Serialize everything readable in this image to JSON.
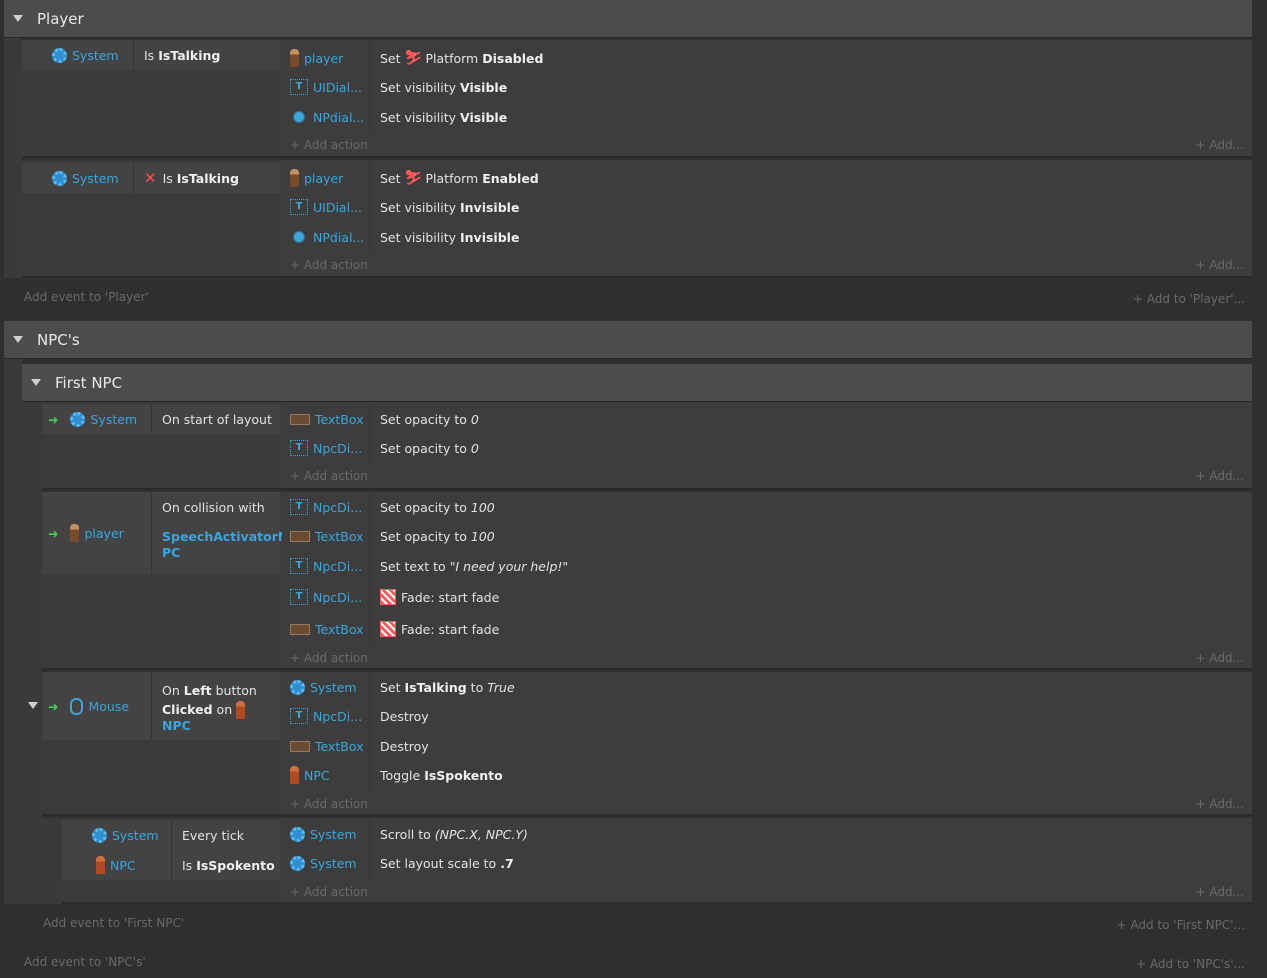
{
  "groups": {
    "player": {
      "title": "Player",
      "add_event": "Add event to 'Player'",
      "add_to": "+ Add to 'Player'..."
    },
    "npcs": {
      "title": "NPC's",
      "add_event": "Add event to 'NPC's'",
      "add_to": "+ Add to 'NPC's'..."
    },
    "first_npc": {
      "title": "First NPC",
      "add_event": "Add event to 'First NPC'",
      "add_to": "+ Add to 'First NPC'..."
    }
  },
  "common": {
    "add_action": "+ Add action",
    "add": "+ Add..."
  },
  "ev1": {
    "cond_obj": "System",
    "cond_pre": "Is",
    "cond_bold": "IsTalking",
    "a1_obj": "player",
    "a1_pre": "Set",
    "a1_mid": "Platform",
    "a1_bold": "Disabled",
    "a2_obj": "UIDial...",
    "a2_pre": "Set visibility",
    "a2_bold": "Visible",
    "a3_obj": "NPdial...",
    "a3_pre": "Set visibility",
    "a3_bold": "Visible"
  },
  "ev2": {
    "cond_obj": "System",
    "cond_pre": "Is",
    "cond_bold": "IsTalking",
    "a1_obj": "player",
    "a1_pre": "Set",
    "a1_mid": "Platform",
    "a1_bold": "Enabled",
    "a2_obj": "UIDial...",
    "a2_pre": "Set visibility",
    "a2_bold": "Invisible",
    "a3_obj": "NPdial...",
    "a3_pre": "Set visibility",
    "a3_bold": "Invisible"
  },
  "ev3": {
    "cond_obj": "System",
    "cond_txt": "On start of layout",
    "a1_obj": "TextBox",
    "a1_pre": "Set opacity to",
    "a1_val": "0",
    "a2_obj": "NpcDi...",
    "a2_pre": "Set opacity to",
    "a2_val": "0"
  },
  "ev4": {
    "cond_obj": "player",
    "cond_txt": "On collision with",
    "cond_target": "SpeechActivatorN PC",
    "a1_obj": "NpcDi...",
    "a1_pre": "Set opacity to",
    "a1_val": "100",
    "a2_obj": "TextBox",
    "a2_pre": "Set opacity to",
    "a2_val": "100",
    "a3_obj": "NpcDi...",
    "a3_pre": "Set text to",
    "a3_val": "\"I need your help!\"",
    "a4_obj": "NpcDi...",
    "a4_txt": "Fade: start fade",
    "a5_obj": "TextBox",
    "a5_txt": "Fade: start fade"
  },
  "ev5": {
    "cond_obj": "Mouse",
    "cond_on": "On",
    "cond_b1": "Left",
    "cond_mid": "button",
    "cond_b2": "Clicked",
    "cond_on2": "on",
    "cond_target": "NPC",
    "a1_obj": "System",
    "a1_pre": "Set",
    "a1_bold": "IsTalking",
    "a1_mid": "to",
    "a1_val": "True",
    "a2_obj": "NpcDi...",
    "a2_txt": "Destroy",
    "a3_obj": "TextBox",
    "a3_txt": "Destroy",
    "a4_obj": "NPC",
    "a4_pre": "Toggle",
    "a4_bold": "IsSpokento"
  },
  "ev6": {
    "c1_obj": "System",
    "c1_txt": "Every tick",
    "c2_obj": "NPC",
    "c2_pre": "Is",
    "c2_bold": "IsSpokento",
    "a1_obj": "System",
    "a1_pre": "Scroll to",
    "a1_val": "(NPC.X, NPC.Y)",
    "a2_obj": "System",
    "a2_pre": "Set layout scale to",
    "a2_bold": ".7"
  },
  "colors": {
    "accent": "#39a6e0",
    "trigger": "#3fcf5a",
    "invert": "#ff4b4b",
    "header": "#4c4c4c"
  }
}
